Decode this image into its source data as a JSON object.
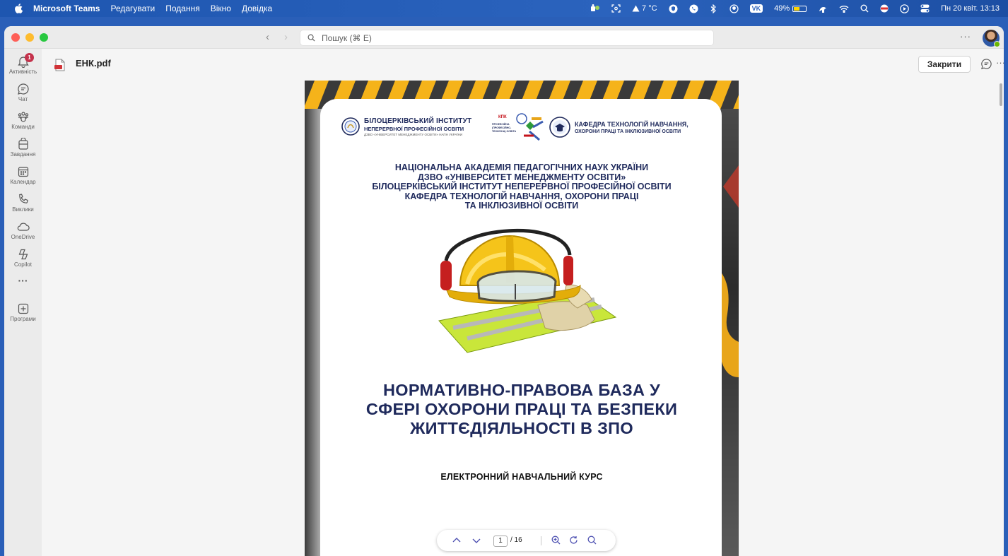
{
  "menubar": {
    "app_name": "Microsoft Teams",
    "items": [
      "Редагувати",
      "Подання",
      "Вікно",
      "Довідка"
    ],
    "weather": "7 °C",
    "vk_label": "VK",
    "battery_percent": "49%",
    "battery_level": 0.49,
    "datetime": "Пн 20 квіт. 13:13"
  },
  "titlebar": {
    "search_placeholder": "Пошук (⌘ E)",
    "more": "···"
  },
  "rail": {
    "items": [
      {
        "label": "Активність",
        "icon": "bell-icon",
        "badge": "1"
      },
      {
        "label": "Чат",
        "icon": "chat-icon"
      },
      {
        "label": "Команди",
        "icon": "teams-icon"
      },
      {
        "label": "Завдання",
        "icon": "tasks-icon"
      },
      {
        "label": "Календар",
        "icon": "calendar-icon"
      },
      {
        "label": "Виклики",
        "icon": "phone-icon"
      },
      {
        "label": "OneDrive",
        "icon": "cloud-icon"
      },
      {
        "label": "Copilot",
        "icon": "copilot-icon"
      },
      {
        "label": "",
        "icon": "more-icon",
        "text": "···"
      },
      {
        "label": "Програми",
        "icon": "add-apps-icon"
      }
    ]
  },
  "document": {
    "file_name": "ЕНК.pdf",
    "close_label": "Закрити",
    "more": "···"
  },
  "page": {
    "institute_line1": "БІЛОЦЕРКІВСЬКИЙ ІНСТИТУТ",
    "institute_line2": "НЕПЕРЕРВНОЇ ПРОФЕСІЙНОЇ ОСВІТИ",
    "institute_line3": "ДЗВО «УНІВЕРСИТЕТ МЕНЕДЖМЕНТУ ОСВІТИ» НАПН УКРАЇНИ",
    "kpk_label": "КПК",
    "kpk_text": "ПРОФЕСІЙНА (ПРОФЕСІЙНО-ТЕХНІЧНА) ОСВІТА",
    "department_line1": "КАФЕДРА ТЕХНОЛОГІЙ НАВЧАННЯ,",
    "department_line2": "ОХОРОНИ ПРАЦІ ТА ІНКЛЮЗИВНОЇ ОСВІТИ",
    "academy_lines": [
      "НАЦІОНАЛЬНА АКАДЕМІЯ ПЕДАГОГІЧНИХ НАУК УКРАЇНИ",
      "ДЗВО «УНІВЕРСИТЕТ МЕНЕДЖМЕНТУ ОСВІТИ»",
      "БІЛОЦЕРКІВСЬКИЙ ІНСТИТУТ НЕПЕРЕРВНОЇ ПРОФЕСІЙНОЇ ОСВІТИ",
      "КАФЕДРА ТЕХНОЛОГІЙ НАВЧАННЯ, ОХОРОНИ ПРАЦІ",
      "ТА ІНКЛЮЗИВНОЇ ОСВІТИ"
    ],
    "title_lines": [
      "НОРМАТИВНО-ПРАВОВА БАЗА У",
      "СФЕРІ ОХОРОНИ ПРАЦІ ТА БЕЗПЕКИ",
      "ЖИТТЄДІЯЛЬНОСТІ В ЗПО"
    ],
    "subtitle": "ЕЛЕКТРОННИЙ НАВЧАЛЬНИЙ КУРС"
  },
  "pager": {
    "current_page": "1",
    "total": "/ 16"
  },
  "colors": {
    "menubar": "#2b63bd",
    "accent": "#4f52b2",
    "navy_text": "#1f2a5c",
    "stripe_yellow": "#f5b31a"
  }
}
